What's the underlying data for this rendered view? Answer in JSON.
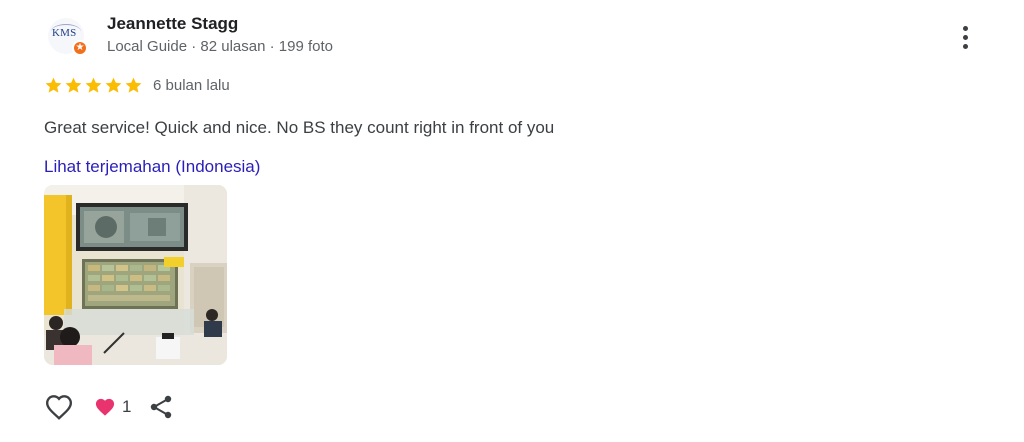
{
  "review": {
    "author": {
      "name": "Jeannette Stagg",
      "meta": "Local Guide · 82 ulasan · 199 foto",
      "avatar_text": "KMS"
    },
    "rating": 5,
    "rating_max": 5,
    "date": "6 bulan lalu",
    "text": "Great service! Quick and nice. No BS they count right in front of you",
    "translate_link": "Lihat terjemahan (Indonesia)",
    "reaction_count": "1"
  },
  "colors": {
    "star": "#fbbc04",
    "link": "#2a1fb8",
    "heart_reaction": "#e8336f",
    "guide_badge": "#f2701d"
  },
  "icons": {
    "more": "more-vert-icon",
    "like": "heart-outline-icon",
    "reaction": "heart-filled-icon",
    "share": "share-icon",
    "guide": "local-guide-badge-icon"
  }
}
